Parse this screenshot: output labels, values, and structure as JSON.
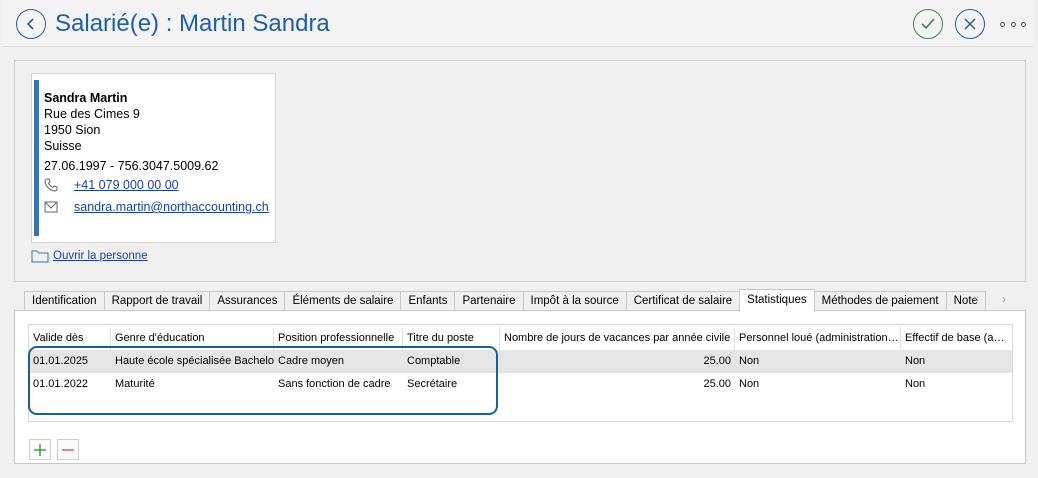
{
  "header": {
    "title": "Salarié(e) : Martin Sandra"
  },
  "person": {
    "name": "Sandra Martin",
    "street": "Rue des Cimes 9",
    "city": "1950 Sion",
    "country": "Suisse",
    "birth_avs": "27.06.1997 - 756.3047.5009.62",
    "phone": "+41 079 000 00 00",
    "email": "sandra.martin@northaccounting.ch",
    "open_label": "Ouvrir la personne"
  },
  "tabs": [
    {
      "label": "Identification"
    },
    {
      "label": "Rapport de travail"
    },
    {
      "label": "Assurances"
    },
    {
      "label": "Éléments de salaire"
    },
    {
      "label": "Enfants"
    },
    {
      "label": "Partenaire"
    },
    {
      "label": "Impôt à la source"
    },
    {
      "label": "Certificat de salaire"
    },
    {
      "label": "Statistiques"
    },
    {
      "label": "Méthodes de paiement"
    },
    {
      "label": "Note"
    }
  ],
  "tab_nav": "‹ ›",
  "grid": {
    "columns": [
      "Valide dès",
      "Genre d'éducation",
      "Position professionnelle",
      "Titre du poste",
      "Nombre de jours de vacances par année civile",
      "Personnel loué (administration…",
      "Effectif de base (a…"
    ],
    "rows": [
      [
        "01.01.2025",
        "Haute école spécialisée Bachelor",
        "Cadre moyen",
        "Comptable",
        "25.00",
        "Non",
        "Non"
      ],
      [
        "01.01.2022",
        "Maturité",
        "Sans fonction de cadre",
        "Secrétaire",
        "25.00",
        "Non",
        "Non"
      ]
    ]
  },
  "colors": {
    "title_blue": "#1f5fa8",
    "highlight_border": "#1e5d99",
    "ok_green": "#3f7f4f",
    "remove_red": "#d9534f",
    "add_green": "#3a9a3a"
  }
}
